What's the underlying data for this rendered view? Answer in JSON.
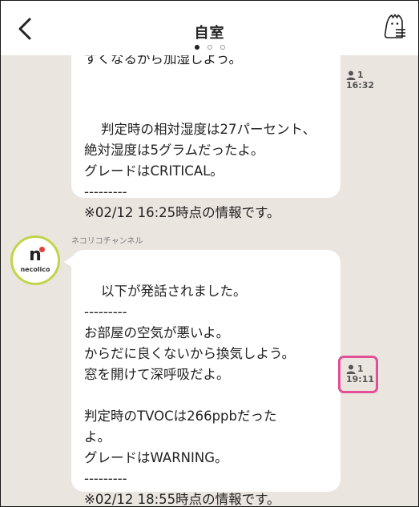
{
  "header": {
    "title": "自室",
    "page_dots": 3,
    "active_dot": 0
  },
  "messages": [
    {
      "text": "判定時の相対湿度は27パーセント、\n絶対湿度は5グラムだったよ。\nグレードはCRITICAL。\n---------\n※02/12 16:25時点の情報です。",
      "partial_top_text": "すくなるから加湿しよう。",
      "read_count": "1",
      "time": "16:32"
    },
    {
      "sender": "ネコリコチャンネル",
      "avatar": {
        "letter": "n",
        "wordmark": "necolico",
        "ring_color": "#c2d44a",
        "dot_color": "#e34040"
      },
      "text": "以下が発話されました。\n---------\nお部屋の空気が悪いよ。\nからだに良くないから換気しよう。\n窓を開けて深呼吸だよ。\n\n判定時のTVOCは266ppbだった\nよ。\nグレードはWARNING。\n---------\n※02/12 18:55時点の情報です。",
      "read_count": "1",
      "time": "19:11",
      "highlight_color": "#e24f95"
    }
  ]
}
